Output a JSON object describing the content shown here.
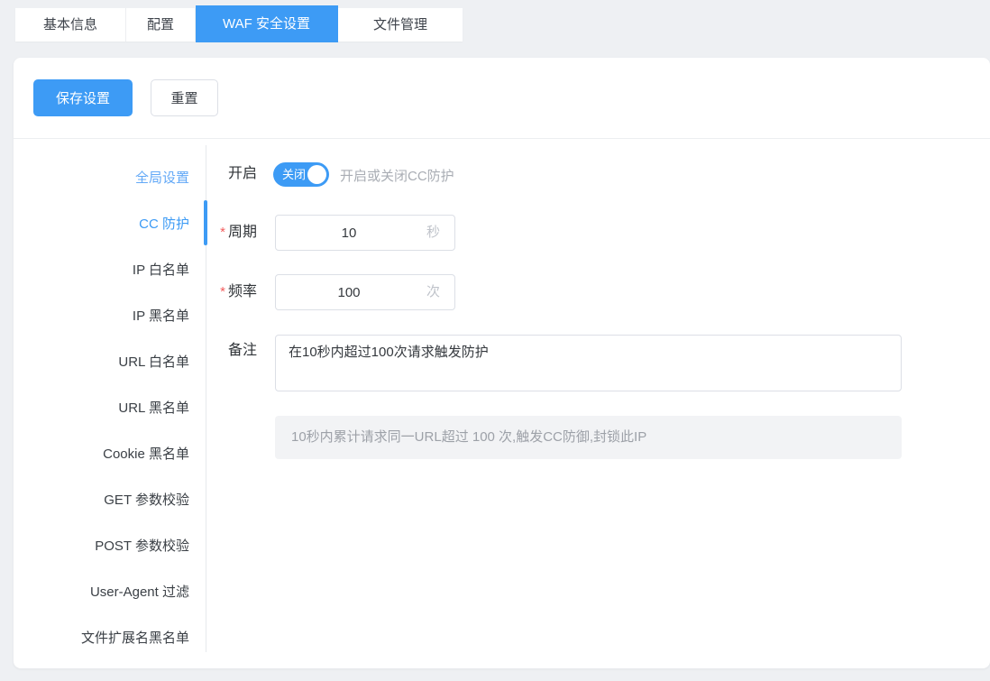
{
  "tabs": [
    {
      "label": "基本信息",
      "active": false
    },
    {
      "label": "配置",
      "active": false
    },
    {
      "label": "WAF 安全设置",
      "active": true
    },
    {
      "label": "文件管理",
      "active": false
    }
  ],
  "toolbar": {
    "save": "保存设置",
    "reset": "重置"
  },
  "sidebar": {
    "active_item": "CC 防护",
    "items": [
      {
        "label": "全局设置"
      },
      {
        "label": "CC 防护"
      },
      {
        "label": "IP 白名单"
      },
      {
        "label": "IP 黑名单"
      },
      {
        "label": "URL 白名单"
      },
      {
        "label": "URL 黑名单"
      },
      {
        "label": "Cookie 黑名单"
      },
      {
        "label": "GET 参数校验"
      },
      {
        "label": "POST 参数校验"
      },
      {
        "label": "User-Agent 过滤"
      },
      {
        "label": "文件扩展名黑名单"
      }
    ]
  },
  "form": {
    "required_mark": "*",
    "enable": {
      "label": "开启",
      "switch_state_text": "关闭",
      "hint": "开启或关闭CC防护"
    },
    "period": {
      "label": "周期",
      "value": "10",
      "unit": "秒"
    },
    "frequency": {
      "label": "频率",
      "value": "100",
      "unit": "次"
    },
    "remark": {
      "label": "备注",
      "value": "在10秒内超过100次请求触发防护"
    },
    "help_text": "10秒内累计请求同一URL超过 100 次,触发CC防御,封锁此IP"
  },
  "colors": {
    "primary": "#3d9bf5",
    "danger": "#f25c5c",
    "hint_text": "#a9adb4",
    "help_bg": "#f2f3f5"
  }
}
